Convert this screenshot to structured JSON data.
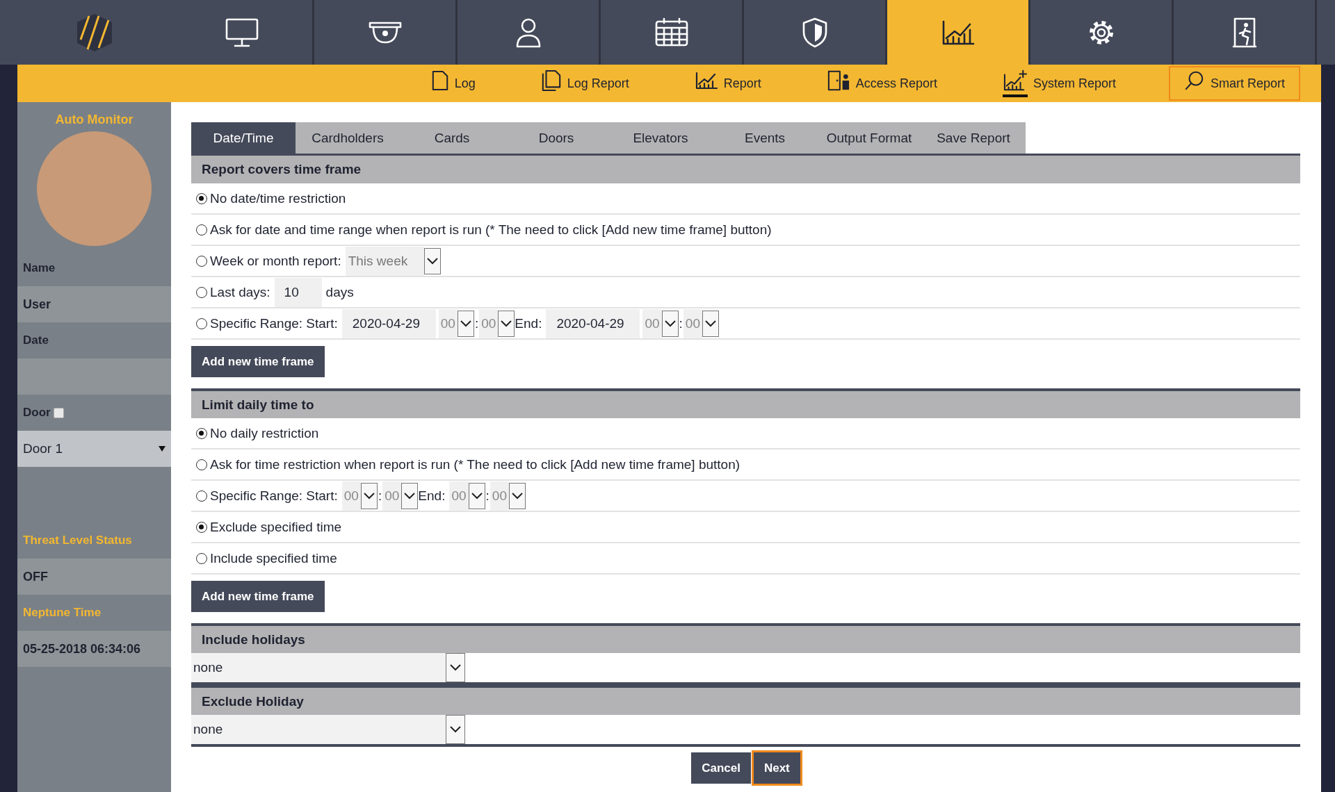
{
  "top_nav": [
    {
      "selected": false
    },
    {
      "selected": false
    },
    {
      "selected": false
    },
    {
      "selected": false
    },
    {
      "selected": false
    },
    {
      "selected": false
    },
    {
      "selected": true
    },
    {
      "selected": false
    },
    {
      "selected": false
    }
  ],
  "sub_nav": [
    {
      "label": "Log",
      "selected": false,
      "underlined": false
    },
    {
      "label": "Log Report",
      "selected": false,
      "underlined": false
    },
    {
      "label": "Report",
      "selected": false,
      "underlined": false
    },
    {
      "label": "Access Report",
      "selected": false,
      "underlined": false
    },
    {
      "label": "System Report",
      "selected": false,
      "underlined": true
    },
    {
      "label": "Smart Report",
      "selected": true,
      "underlined": false
    }
  ],
  "sidebar": {
    "title": "Auto Monitor",
    "rows": [
      {
        "kind": "label",
        "text": "Name"
      },
      {
        "kind": "value",
        "text": "User"
      },
      {
        "kind": "label",
        "text": "Date"
      },
      {
        "kind": "value"
      },
      {
        "kind": "checkbox",
        "text": "Door",
        "checked": false
      },
      {
        "kind": "select",
        "text": "Door 1"
      },
      {
        "kind": "gap"
      },
      {
        "kind": "heading",
        "text": "Threat Level Status"
      },
      {
        "kind": "value",
        "text": "OFF"
      },
      {
        "kind": "heading",
        "text": "Neptune Time"
      },
      {
        "kind": "value",
        "text": "05-25-2018 06:34:06"
      }
    ]
  },
  "tabs": [
    {
      "label": "Date/Time",
      "selected": true
    },
    {
      "label": "Cardholders",
      "selected": false
    },
    {
      "label": "Cards",
      "selected": false
    },
    {
      "label": "Doors",
      "selected": false
    },
    {
      "label": "Elevators",
      "selected": false
    },
    {
      "label": "Events",
      "selected": false
    },
    {
      "label": "Output Format",
      "selected": false
    },
    {
      "label": "Save Report",
      "selected": false
    }
  ],
  "sections": [
    {
      "kind": "radios",
      "title": "Report covers time frame",
      "button": "Add new time frame",
      "rows": [
        {
          "selected": true,
          "parts": [
            {
              "kind": "label",
              "text": "No date/time restriction"
            }
          ]
        },
        {
          "selected": false,
          "parts": [
            {
              "kind": "label",
              "text": "Ask for date and time range when report is run (* The need to click [Add new time frame] button)"
            }
          ]
        },
        {
          "selected": false,
          "parts": [
            {
              "kind": "label",
              "text": "Week or month report:"
            },
            {
              "kind": "select",
              "value": "This week"
            }
          ]
        },
        {
          "selected": false,
          "parts": [
            {
              "kind": "label",
              "text": "Last days:"
            },
            {
              "kind": "input",
              "value": "10"
            },
            {
              "kind": "label",
              "text": "days"
            }
          ]
        },
        {
          "selected": false,
          "parts": [
            {
              "kind": "label",
              "text": "Specific Range: Start:"
            },
            {
              "kind": "date",
              "value": "2020-04-29"
            },
            {
              "kind": "hour",
              "value": "00"
            },
            {
              "kind": "sep",
              "text": ":"
            },
            {
              "kind": "hour",
              "value": "00"
            },
            {
              "kind": "label",
              "text": "End:"
            },
            {
              "kind": "date",
              "value": "2020-04-29"
            },
            {
              "kind": "hour",
              "value": "00"
            },
            {
              "kind": "sep",
              "text": ":"
            },
            {
              "kind": "hour",
              "value": "00"
            }
          ]
        }
      ]
    },
    {
      "kind": "radios",
      "title": "Limit daily time to",
      "button": "Add new time frame",
      "rows": [
        {
          "selected": true,
          "parts": [
            {
              "kind": "label",
              "text": "No daily restriction"
            }
          ]
        },
        {
          "selected": false,
          "parts": [
            {
              "kind": "label",
              "text": "Ask for time restriction when report is run (* The need to click [Add new time frame] button)"
            }
          ]
        },
        {
          "selected": false,
          "parts": [
            {
              "kind": "label",
              "text": "Specific Range: Start:"
            },
            {
              "kind": "hour",
              "value": "00"
            },
            {
              "kind": "sep",
              "text": ":"
            },
            {
              "kind": "hour",
              "value": "00"
            },
            {
              "kind": "label",
              "text": "End:"
            },
            {
              "kind": "hour",
              "value": "00"
            },
            {
              "kind": "sep",
              "text": ":"
            },
            {
              "kind": "hour",
              "value": "00"
            }
          ]
        },
        {
          "selected": true,
          "parts": [
            {
              "kind": "label",
              "text": "Exclude specified time"
            }
          ]
        },
        {
          "selected": false,
          "parts": [
            {
              "kind": "label",
              "text": "Include specified time"
            }
          ]
        }
      ]
    },
    {
      "kind": "select",
      "title": "Include holidays",
      "value": "none"
    },
    {
      "kind": "select",
      "title": "Exclude Holiday",
      "value": "none"
    }
  ],
  "footer": [
    {
      "label": "Cancel",
      "focused": false
    },
    {
      "label": "Next",
      "focused": true
    }
  ]
}
